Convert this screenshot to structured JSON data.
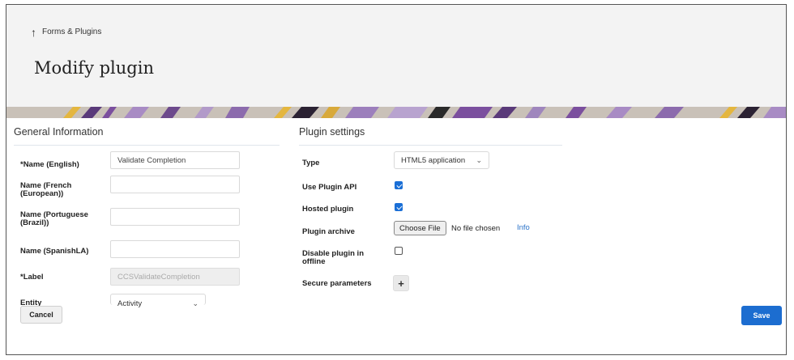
{
  "breadcrumb": {
    "icon": "up-arrow-icon",
    "label": "Forms & Plugins"
  },
  "page_title": "Modify plugin",
  "general": {
    "title": "General Information",
    "fields": [
      {
        "label": "*Name (English)",
        "value": "Validate Completion"
      },
      {
        "label": "Name (French (European))",
        "value": ""
      },
      {
        "label": "Name (Portuguese (Brazil))",
        "value": ""
      },
      {
        "label": "Name (SpanishLA)",
        "value": ""
      },
      {
        "label": "*Label",
        "value": "CCSValidateCompletion"
      },
      {
        "label": "Entity",
        "value": "Activity"
      }
    ]
  },
  "plugin": {
    "title": "Plugin settings",
    "type_label": "Type",
    "type_value": "HTML5 application",
    "use_api_label": "Use Plugin API",
    "use_api": true,
    "hosted_label": "Hosted plugin",
    "hosted": true,
    "archive_label": "Plugin archive",
    "choose_file": "Choose File",
    "no_file": "No file chosen",
    "info": "Info",
    "offline_label": "Disable plugin in offline",
    "offline": false,
    "secure_label": "Secure parameters",
    "add_icon": "plus-icon"
  },
  "actions": {
    "cancel": "Cancel",
    "save": "Save"
  },
  "colors": {
    "accent": "#1c6dd0",
    "banner_purple": "#7b4f9e",
    "banner_gold": "#d8a93a"
  }
}
